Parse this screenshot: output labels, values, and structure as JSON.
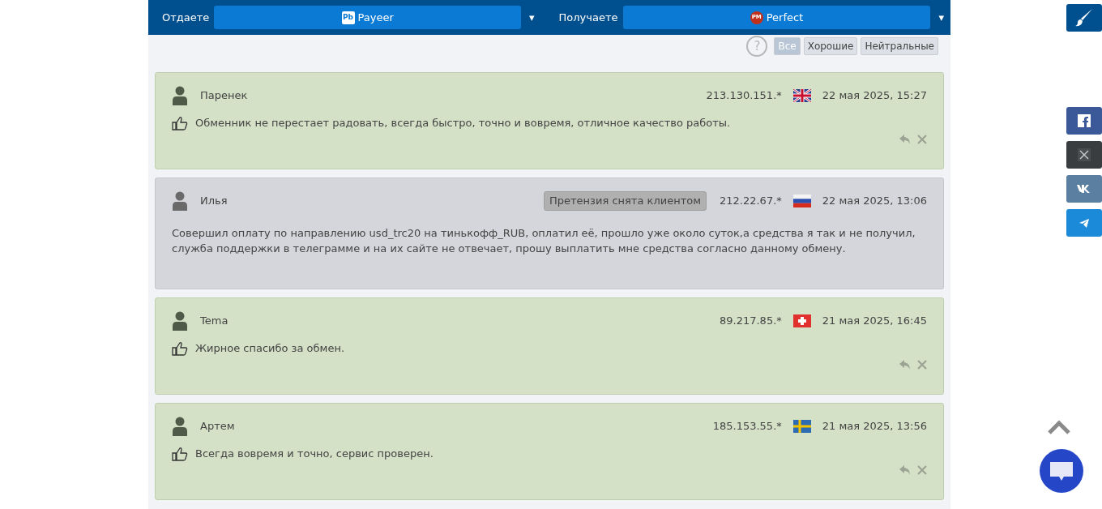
{
  "header": {
    "give_label": "Отдаете",
    "give_currency": "Payeer",
    "give_logo": "Pb",
    "give_caret": "▾",
    "get_label": "Получаете",
    "get_currency": "Perfect",
    "get_logo": "PM",
    "get_caret": "▾"
  },
  "help": "?",
  "filters": [
    {
      "label": "Все",
      "selected": true
    },
    {
      "label": "Хорошие",
      "selected": false
    },
    {
      "label": "Нейтральные",
      "selected": false
    }
  ],
  "reviews": [
    {
      "kind": "positive",
      "author": "Паренек",
      "ip": "213.130.151.*",
      "flag": {
        "kind": "gb"
      },
      "date": "22 мая 2025, 15:27",
      "text": "Обменник не перестает радовать, всегда быстро, точно и вовремя, отличное качество работы."
    },
    {
      "kind": "claim",
      "author": "Илья",
      "badge": "Претензия снята клиентом",
      "ip": "212.22.67.*",
      "flag": {
        "kind": "ru"
      },
      "date": "22 мая 2025, 13:06",
      "text": "Совершил оплату по направлению usd_trc20 на тинькофф_RUB, оплатил её, прошло уже около суток,а средства я так и не получил, служба поддержки в телеграмме и на их сайте не отвечает, прошу выплатить мне средства согласно данному обмену."
    },
    {
      "kind": "positive",
      "author": "Tema",
      "ip": "89.217.85.*",
      "flag": {
        "kind": "ch"
      },
      "date": "21 мая 2025, 16:45",
      "text": "Жирное спасибо за обмен."
    },
    {
      "kind": "positive",
      "author": "Артем",
      "ip": "185.153.55.*",
      "flag": {
        "kind": "se"
      },
      "date": "21 мая 2025, 13:56",
      "text": "Всегда вовремя и точно, сервис проверен."
    }
  ]
}
